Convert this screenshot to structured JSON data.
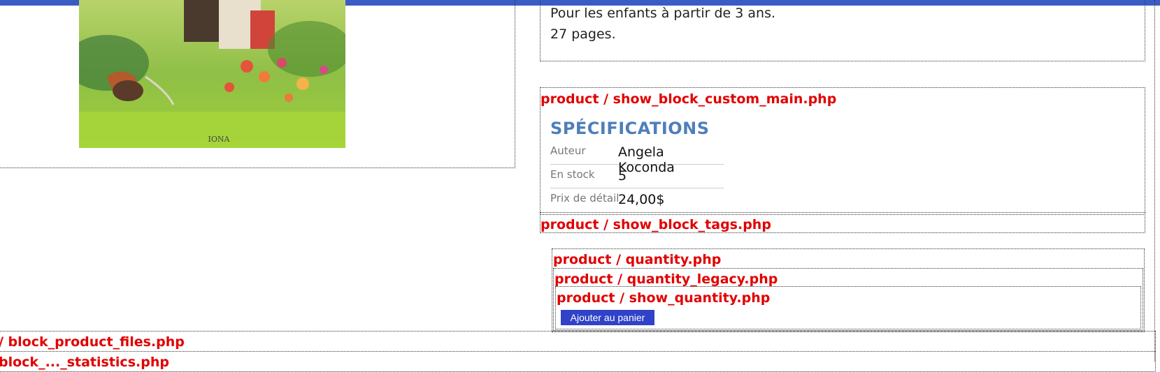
{
  "description": {
    "line1": "Pour les enfants à partir de 3 ans.",
    "line2": "27 pages."
  },
  "image": {
    "caption": "IONA"
  },
  "blocks": {
    "custom_main": "product / show_block_custom_main.php",
    "tags": "product / show_block_tags.php",
    "quantity": "product / quantity.php",
    "quantity_legacy": "product / quantity_legacy.php",
    "show_quantity": "product / show_quantity.php",
    "product_files": "/ block_product_files.php",
    "next_block": "block_..._statistics.php"
  },
  "specifications": {
    "title": "SPÉCIFICATIONS",
    "rows": [
      {
        "label": "Auteur",
        "value": "Angela Koconda"
      },
      {
        "label": "En stock",
        "value": "5"
      },
      {
        "label": "Prix de détail",
        "value": "24,00$"
      }
    ]
  },
  "cart": {
    "button_label": "Ajouter au panier"
  },
  "colors": {
    "top_bar": "#3b5cc4",
    "debug_label": "#e10000",
    "spec_title": "#4f7fb8",
    "button": "#3042c8"
  }
}
